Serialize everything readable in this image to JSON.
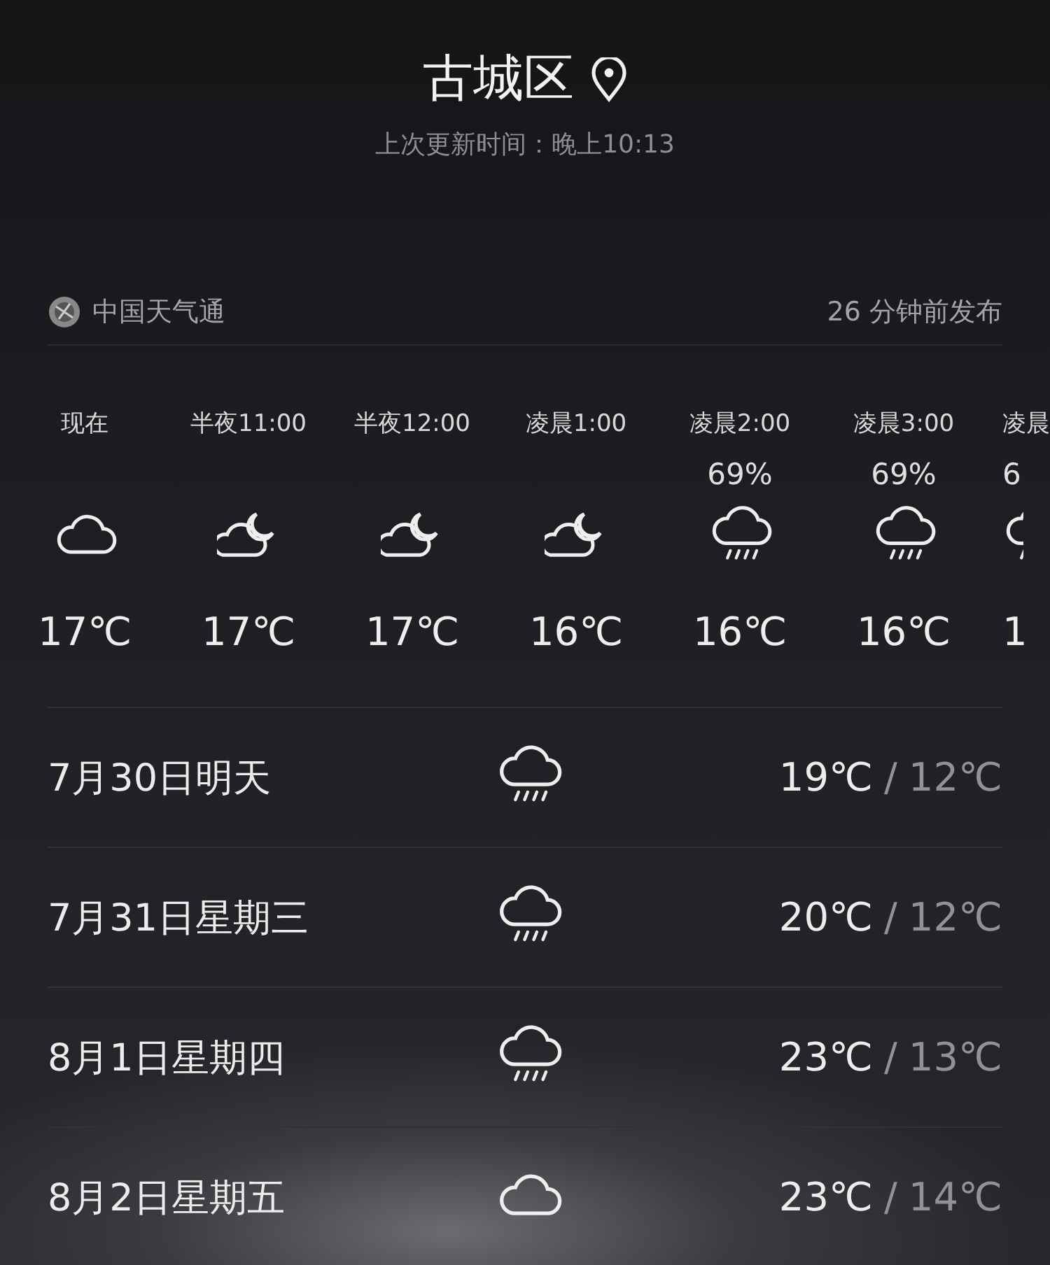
{
  "header": {
    "city": "古城区",
    "updated": "上次更新时间：晚上10:13"
  },
  "source": {
    "name": "中国天气通",
    "published": "26 分钟前发布"
  },
  "hourly": [
    {
      "time": "现在",
      "kind": "cloudy",
      "temp": "17℃"
    },
    {
      "time": "半夜11:00",
      "kind": "night",
      "temp": "17℃"
    },
    {
      "time": "半夜12:00",
      "kind": "night",
      "temp": "17℃"
    },
    {
      "time": "凌晨1:00",
      "kind": "night",
      "temp": "16℃"
    },
    {
      "time": "凌晨2:00",
      "pop": "69%",
      "kind": "rain",
      "temp": "16℃"
    },
    {
      "time": "凌晨3:00",
      "pop": "69%",
      "kind": "rain",
      "temp": "16℃"
    },
    {
      "time": "凌晨",
      "pop": "6",
      "kind": "rain",
      "temp": "1"
    }
  ],
  "daily": [
    {
      "date": "7月30日明天",
      "kind": "rain",
      "high": "19℃",
      "sep": "/",
      "low": "12℃"
    },
    {
      "date": "7月31日星期三",
      "kind": "rain",
      "high": "20℃",
      "sep": "/",
      "low": "12℃"
    },
    {
      "date": "8月1日星期四",
      "kind": "rain",
      "high": "23℃",
      "sep": "/",
      "low": "13℃"
    },
    {
      "date": "8月2日星期五",
      "kind": "cloudy",
      "high": "23℃",
      "sep": "/",
      "low": "14℃"
    }
  ]
}
